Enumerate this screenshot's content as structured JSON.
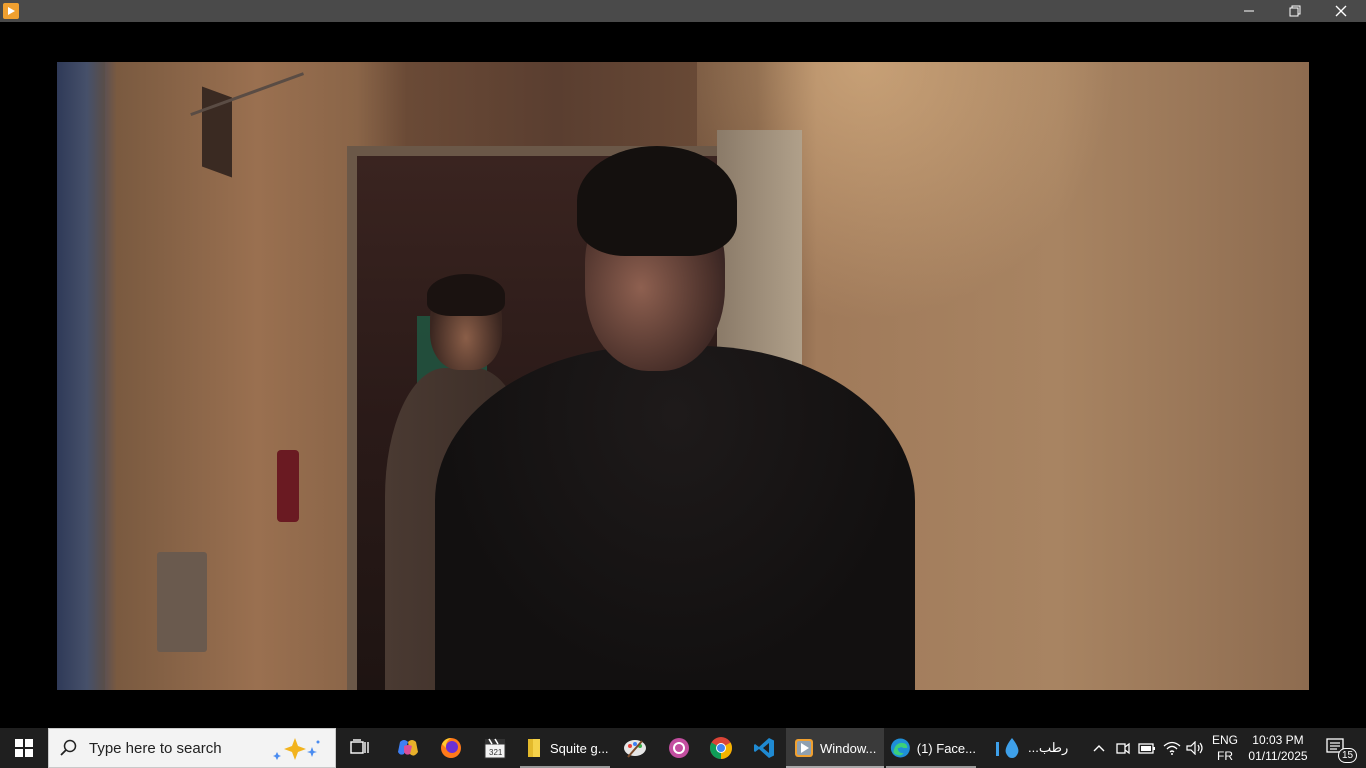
{
  "window": {
    "app_icon": "media-player-icon",
    "controls": [
      "minimize-icon",
      "restore-icon",
      "close-icon"
    ]
  },
  "taskbar": {
    "search_placeholder": "Type here to search",
    "apps": [
      {
        "name": "task-view",
        "icon": "task-view-icon"
      },
      {
        "name": "copilot",
        "icon": "copilot-icon"
      },
      {
        "name": "firefox",
        "icon": "firefox-icon"
      },
      {
        "name": "video-editor",
        "icon": "clapperboard-icon"
      },
      {
        "name": "file-explorer",
        "label": "Squite g...",
        "icon": "folder-icon"
      },
      {
        "name": "paint",
        "icon": "paint-palette-icon"
      },
      {
        "name": "media-circle",
        "icon": "circle-ring-icon"
      },
      {
        "name": "chrome",
        "icon": "chrome-icon"
      },
      {
        "name": "vscode",
        "icon": "vscode-icon"
      },
      {
        "name": "media-player",
        "label": "Window...",
        "icon": "media-player-icon",
        "active": true
      },
      {
        "name": "edge-facebook",
        "label": "(1) Face...",
        "icon": "edge-icon"
      },
      {
        "name": "water-app",
        "label": "رطب...",
        "icon": "water-drop-icon"
      }
    ],
    "tray": {
      "language_top": "ENG",
      "language_bottom": "FR",
      "time": "10:03 PM",
      "date": "01/11/2025",
      "notifications": "15"
    }
  }
}
